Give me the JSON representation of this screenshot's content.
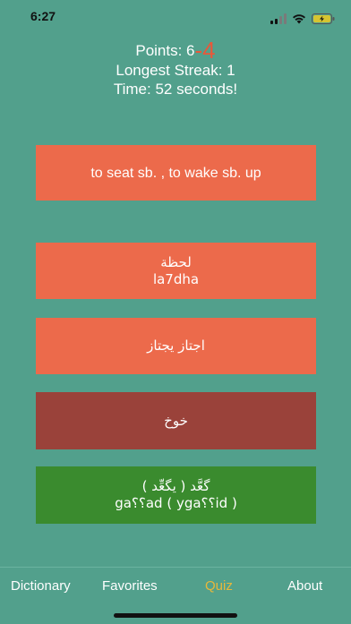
{
  "status_bar": {
    "time": "6:27",
    "icons": [
      "signal-icon",
      "wifi-icon",
      "battery-charging-icon"
    ]
  },
  "stats": {
    "points_label": "Points: 6",
    "points_delta": "-4",
    "longest_streak": "Longest Streak: 1",
    "time": "Time: 52 seconds!"
  },
  "question": {
    "prompt": "to seat sb. ,  to wake sb. up"
  },
  "options": [
    {
      "arabic": "لحظة",
      "latin": "la7dha",
      "state": "neutral"
    },
    {
      "arabic": "اجتاز يجتاز",
      "latin": "",
      "state": "neutral"
    },
    {
      "arabic": "خوخ",
      "latin": "",
      "state": "wrong"
    },
    {
      "arabic": "گعَّد  ( يگعِّد )",
      "latin": "ga؟؟ad ( yga؟؟id )",
      "state": "correct"
    }
  ],
  "colors": {
    "background": "#52a08c",
    "option_neutral": "#ec6a4b",
    "option_wrong": "#9a423a",
    "option_correct": "#3a8b2e",
    "delta": "#e8583a",
    "active_tab": "#e8b83a"
  },
  "tabs": [
    {
      "label": "Dictionary",
      "active": false
    },
    {
      "label": "Favorites",
      "active": false
    },
    {
      "label": "Quiz",
      "active": true
    },
    {
      "label": "About",
      "active": false
    }
  ]
}
